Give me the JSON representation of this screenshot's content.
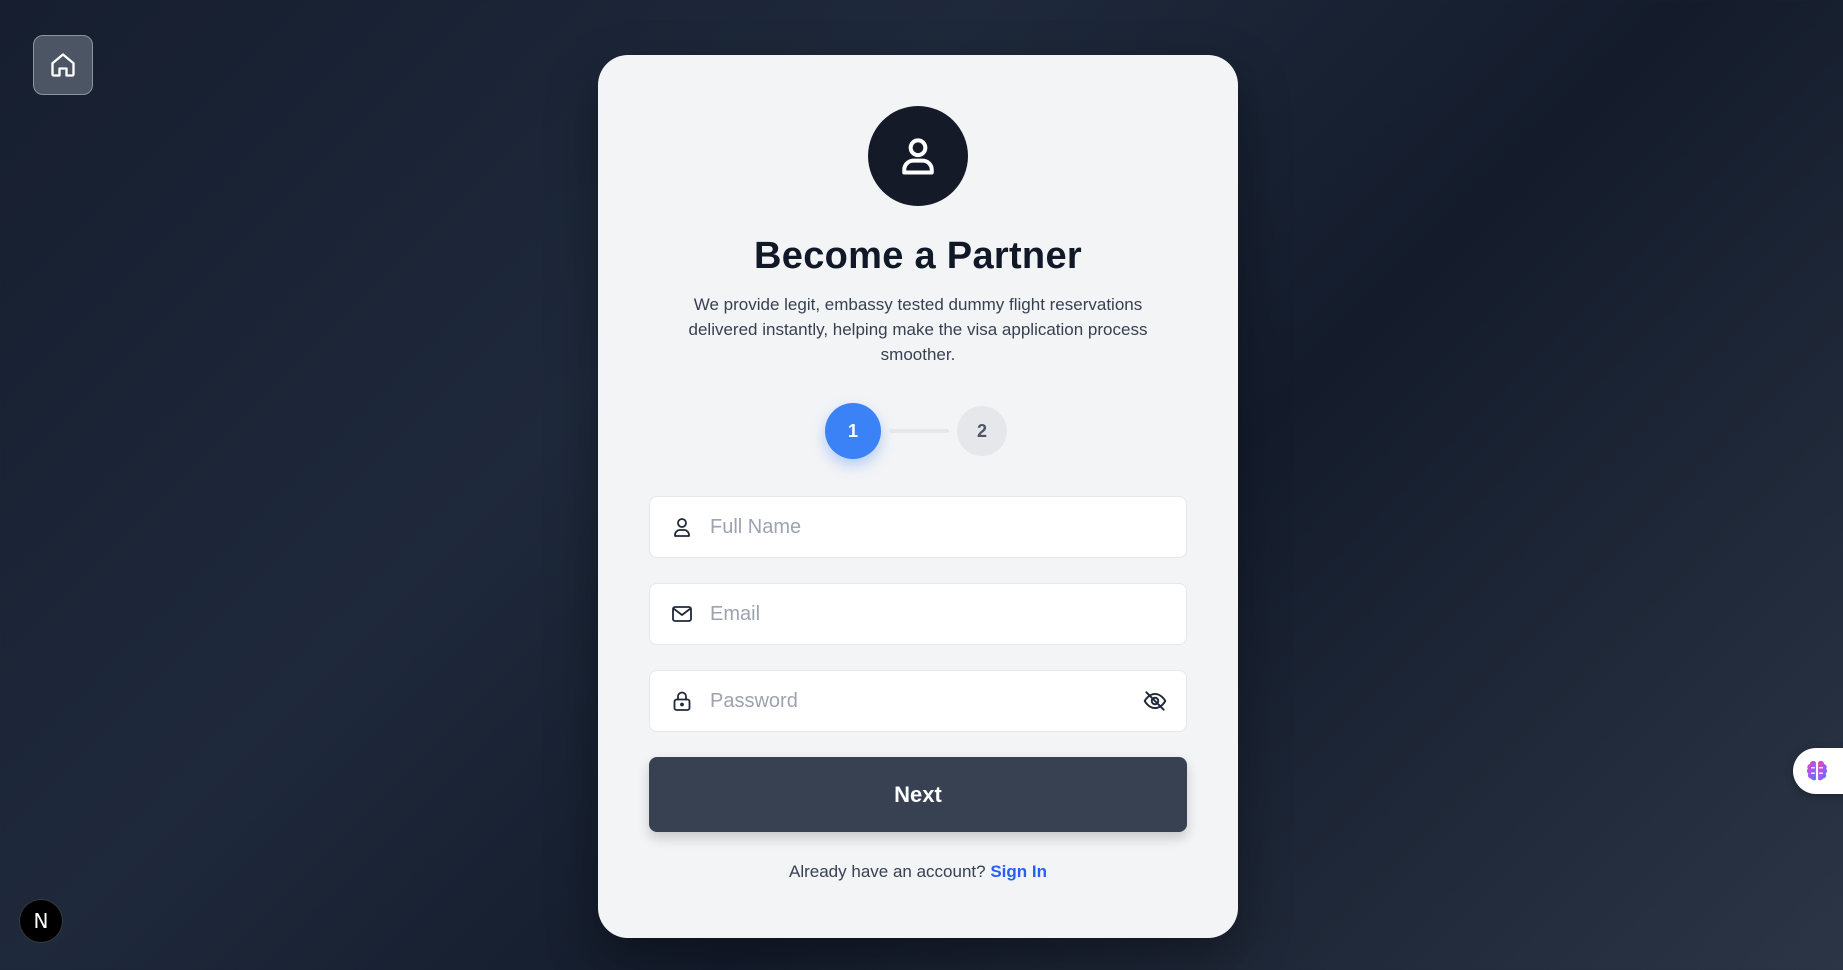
{
  "nav": {
    "home_icon": "home-icon"
  },
  "card": {
    "avatar_icon": "user-icon",
    "title": "Become a Partner",
    "subtitle": "We provide legit, embassy tested dummy flight reservations delivered instantly, helping make the visa application process smoother."
  },
  "stepper": {
    "steps": [
      {
        "label": "1",
        "active": true
      },
      {
        "label": "2",
        "active": false
      }
    ],
    "active_color": "#3b82f6",
    "inactive_color": "#e5e7eb"
  },
  "form": {
    "full_name": {
      "placeholder": "Full Name",
      "value": "",
      "icon": "user-icon"
    },
    "email": {
      "placeholder": "Email",
      "value": "",
      "icon": "mail-icon"
    },
    "password": {
      "placeholder": "Password",
      "value": "",
      "icon": "lock-icon",
      "toggle_icon": "eye-off-icon"
    },
    "submit_label": "Next"
  },
  "footer": {
    "prompt": "Already have an account?",
    "link_label": "Sign In"
  },
  "overlays": {
    "next_badge_label": "N",
    "side_widget_icon": "brain-icon"
  },
  "colors": {
    "primary_button": "#374151",
    "link": "#2563eb",
    "card_background": "#f3f4f6"
  }
}
